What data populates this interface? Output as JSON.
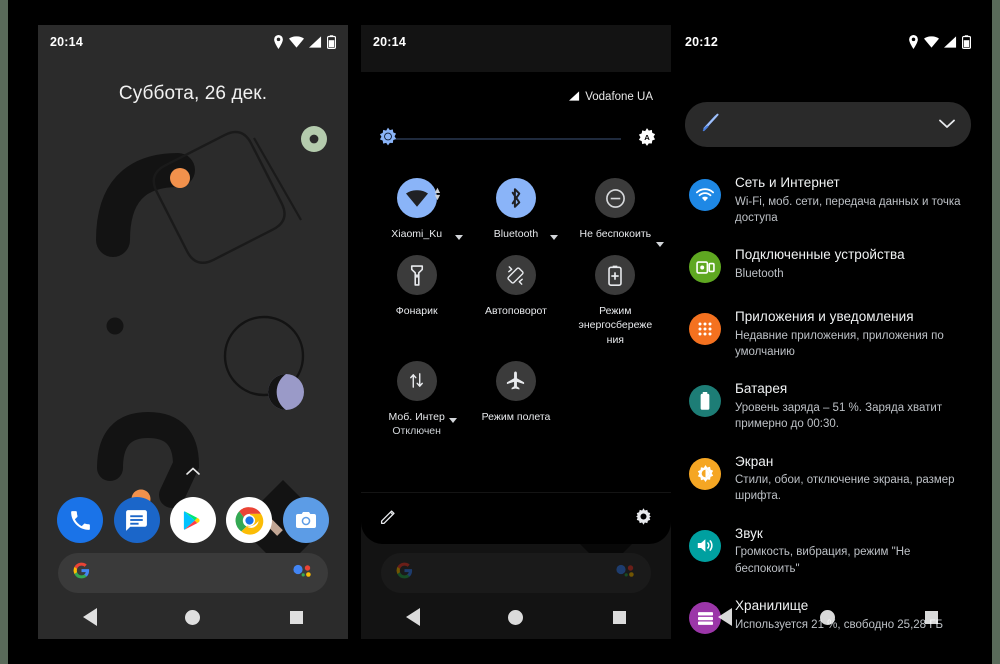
{
  "page": {
    "background_color": "#5a6a5a",
    "frame_color": "#000000"
  },
  "phone1": {
    "name": "home-screen",
    "statusbar": {
      "clock": "20:14",
      "icons": [
        "location-pin-icon",
        "wifi-icon",
        "signal-icon",
        "battery-icon"
      ]
    },
    "date_widget": "Суббота, 26 дек.",
    "dock": [
      {
        "app": "phone",
        "label": "Phone",
        "color": "#1a73e8"
      },
      {
        "app": "messages",
        "label": "Messages",
        "color": "#1b66c9"
      },
      {
        "app": "play-store",
        "label": "Google Play",
        "color": "#ffffff"
      },
      {
        "app": "chrome",
        "label": "Chrome",
        "color": "#ffffff"
      },
      {
        "app": "camera",
        "label": "Camera",
        "color": "#5c9ce6"
      }
    ],
    "search_bar": {
      "left_icon": "google-g-icon",
      "right_icon": "google-assistant-icon",
      "value": ""
    },
    "navbar": [
      "back-button",
      "home-button",
      "recents-button"
    ]
  },
  "phone2": {
    "name": "quick-settings-panel",
    "statusbar": {
      "clock": "20:14"
    },
    "carrier": "Vodafone UA",
    "brightness": {
      "level_percent": 3,
      "left_icon": "brightness-icon",
      "right_icon": "auto-brightness-icon"
    },
    "tiles": [
      {
        "label": "Xiaomi_Ku",
        "sub": "",
        "icon": "wifi-icon",
        "active": true,
        "has_caret": true
      },
      {
        "label": "Bluetooth",
        "sub": "",
        "icon": "bluetooth-icon",
        "active": true,
        "has_caret": true
      },
      {
        "label": "Не беспокоить",
        "sub": "",
        "icon": "do-not-disturb-icon",
        "active": false,
        "has_caret": true
      },
      {
        "label": "Фонарик",
        "sub": "",
        "icon": "flashlight-icon",
        "active": false,
        "has_caret": false
      },
      {
        "label": "Автоповорот",
        "sub": "",
        "icon": "auto-rotate-icon",
        "active": false,
        "has_caret": false
      },
      {
        "label": "Режим энергосбережения",
        "sub": "",
        "icon": "battery-saver-icon",
        "active": false,
        "has_caret": false
      },
      {
        "label": "Моб. Интер",
        "sub": "Отключен",
        "icon": "mobile-data-icon",
        "active": false,
        "has_caret": true
      },
      {
        "label": "Режим полета",
        "sub": "",
        "icon": "airplane-icon",
        "active": false,
        "has_caret": false
      }
    ],
    "footer": {
      "edit_icon": "pencil-edit-icon",
      "settings_icon": "gear-icon"
    },
    "search_bar": {
      "left_icon": "google-g-icon",
      "right_icon": "google-assistant-icon"
    },
    "navbar": [
      "back-button",
      "home-button",
      "recents-button"
    ]
  },
  "phone3": {
    "name": "settings-screen",
    "statusbar": {
      "clock": "20:12",
      "icons": [
        "location-pin-icon",
        "wifi-icon",
        "signal-icon",
        "battery-icon"
      ]
    },
    "search_card": {
      "icon": "crossed-pen-icon",
      "chevron": "chevron-down-icon",
      "value": ""
    },
    "items": [
      {
        "title": "Сеть и Интернет",
        "subtitle": "Wi-Fi, моб. сети, передача данных и точка доступа",
        "icon": "wifi-icon",
        "color": "#1e88e5"
      },
      {
        "title": "Подключенные устройства",
        "subtitle": "Bluetooth",
        "icon": "connected-devices-icon",
        "color": "#5fa821"
      },
      {
        "title": "Приложения и уведомления",
        "subtitle": "Недавние приложения, приложения по умолчанию",
        "icon": "apps-grid-icon",
        "color": "#f4711f"
      },
      {
        "title": "Батарея",
        "subtitle": "Уровень заряда – 51 %. Заряда хватит примерно до 00:30.",
        "icon": "battery-icon",
        "color": "#1d7d76"
      },
      {
        "title": "Экран",
        "subtitle": "Стили, обои, отключение экрана, размер шрифта.",
        "icon": "display-brightness-icon",
        "color": "#f5a623"
      },
      {
        "title": "Звук",
        "subtitle": "Громкость, вибрация, режим \"Не беспокоить\"",
        "icon": "speaker-volume-icon",
        "color": "#00a0a0"
      },
      {
        "title": "Хранилище",
        "subtitle": "Используется 21 %, свободно 25,28 ГБ",
        "icon": "storage-icon",
        "color": "#9b36a8"
      }
    ],
    "navbar": [
      "back-button",
      "home-button",
      "recents-button"
    ]
  }
}
